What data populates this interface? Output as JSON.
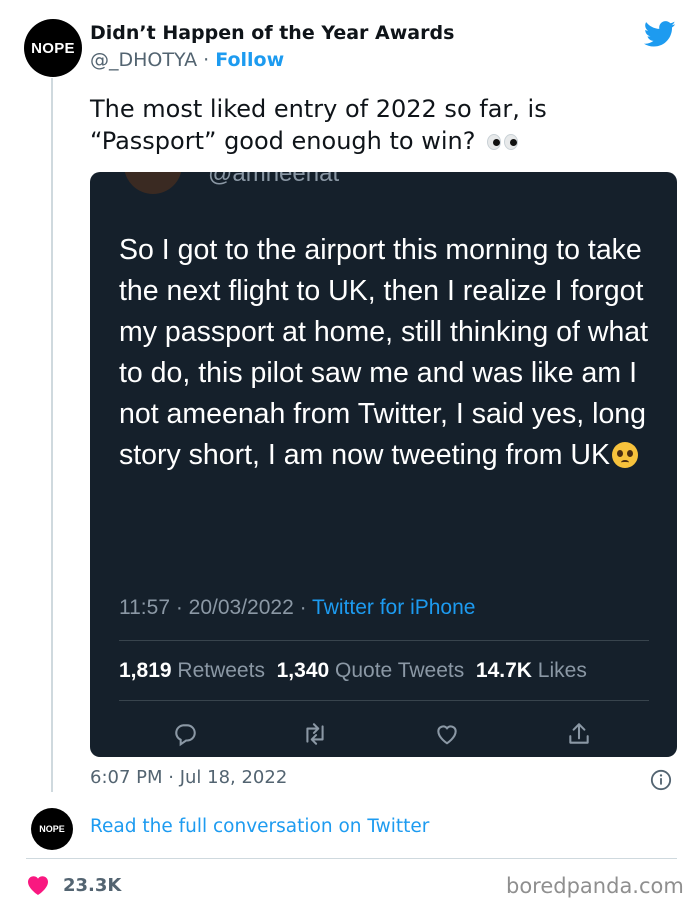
{
  "author": {
    "avatar_text": "NOPE",
    "display_name": "Didn’t Happen of the Year Awards",
    "handle": "@_DHOTYA",
    "separator": " · ",
    "follow_label": "Follow"
  },
  "tweet": {
    "text": "The most liked entry of 2022 so far, is “Passport” good enough to win?",
    "timestamp": "6:07 PM · Jul 18, 2022"
  },
  "embedded": {
    "handle": "@amneenat",
    "text": "So I got to the airport this morning to take the next flight to UK, then I realize I forgot my passport at home, still thinking of what to do, this pilot saw me and was like am I not ameenah from Twitter, I said yes, long story short, I am now tweeting from UK",
    "time": "11:57 · 20/03/2022 · ",
    "source": "Twitter for iPhone",
    "retweets_count": "1,819",
    "retweets_label": "Retweets",
    "quotes_count": "1,340",
    "quotes_label": "Quote Tweets",
    "likes_count": "14.7K",
    "likes_label": "Likes"
  },
  "footer": {
    "avatar_text": "NOPE",
    "read_link": "Read the full conversation on Twitter",
    "like_count": "23.3K",
    "watermark": "boredpanda.com"
  },
  "colors": {
    "accent": "#1d9bf0",
    "card_bg": "#15202b",
    "heart": "#f91880"
  }
}
